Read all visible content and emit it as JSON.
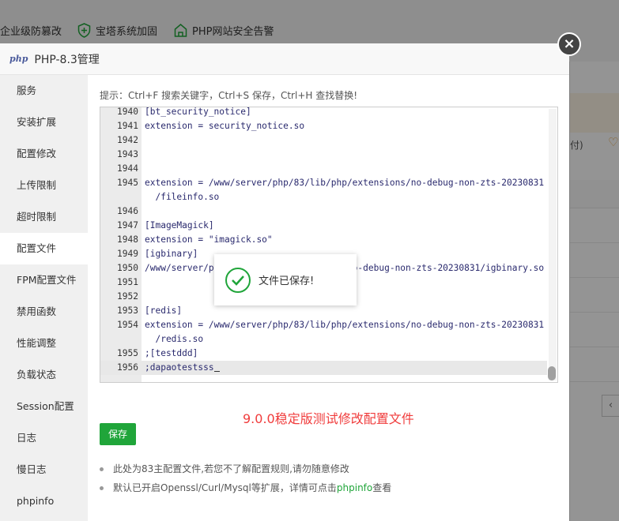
{
  "background": {
    "links": [
      {
        "label": "企业级防篡改",
        "icon": "shield-edit-icon"
      },
      {
        "label": "宝塔系统加固",
        "icon": "shield-plus-icon"
      },
      {
        "label": "PHP网站安全告警",
        "icon": "house-alert-icon"
      }
    ],
    "right_texts": [
      "付)",
      "♡"
    ]
  },
  "modal": {
    "logo": "php",
    "title": "PHP-8.3管理",
    "close_label": "×"
  },
  "sidebar": {
    "items": [
      {
        "label": "服务"
      },
      {
        "label": "安装扩展"
      },
      {
        "label": "配置修改"
      },
      {
        "label": "上传限制"
      },
      {
        "label": "超时限制"
      },
      {
        "label": "配置文件"
      },
      {
        "label": "FPM配置文件"
      },
      {
        "label": "禁用函数"
      },
      {
        "label": "性能调整"
      },
      {
        "label": "负载状态"
      },
      {
        "label": "Session配置"
      },
      {
        "label": "日志"
      },
      {
        "label": "慢日志"
      },
      {
        "label": "phpinfo"
      }
    ],
    "active": "配置文件"
  },
  "content": {
    "tip": "提示：Ctrl+F 搜索关键字，Ctrl+S 保存，Ctrl+H 查找替换!",
    "editor": {
      "lines": [
        {
          "num": "1940",
          "text": "[bt_security_notice]"
        },
        {
          "num": "1941",
          "text": "extension = security_notice.so"
        },
        {
          "num": "1942",
          "text": ""
        },
        {
          "num": "1943",
          "text": ""
        },
        {
          "num": "1944",
          "text": ""
        },
        {
          "num": "1945",
          "text": "extension = /www/server/php/83/lib/php/extensions/no-debug-non-zts-20230831\n  /fileinfo.so"
        },
        {
          "num": "1946",
          "text": ""
        },
        {
          "num": "1947",
          "text": "[ImageMagick]"
        },
        {
          "num": "1948",
          "text": "extension = \"imagick.so\""
        },
        {
          "num": "1949",
          "text": "[igbinary]"
        },
        {
          "num": "1950",
          "text": "/www/server/php/83/lib/php/extensions/no-debug-non-zts-20230831/igbinary.so"
        },
        {
          "num": "1951",
          "text": ""
        },
        {
          "num": "1952",
          "text": ""
        },
        {
          "num": "1953",
          "text": "[redis]"
        },
        {
          "num": "1954",
          "text": "extension = /www/server/php/83/lib/php/extensions/no-debug-non-zts-20230831\n  /redis.so"
        },
        {
          "num": "1955",
          "text": ";[testddd]"
        },
        {
          "num": "1956",
          "text": ";dapaotestsss"
        }
      ]
    },
    "annotation": "9.0.0稳定版测试修改配置文件",
    "save_label": "保存",
    "notes": [
      {
        "text": "此处为83主配置文件,若您不了解配置规则,请勿随意修改"
      },
      {
        "text_before": "默认已开启Openssl/Curl/Mysql等扩展，详情可点击",
        "link": "phpinfo",
        "text_after": "查看"
      }
    ]
  },
  "toast": {
    "icon": "check-circle-icon",
    "message": "文件已保存!"
  },
  "colors": {
    "accent": "#20a53a",
    "annotation": "#f03c3c",
    "close_bg": "#444444"
  }
}
